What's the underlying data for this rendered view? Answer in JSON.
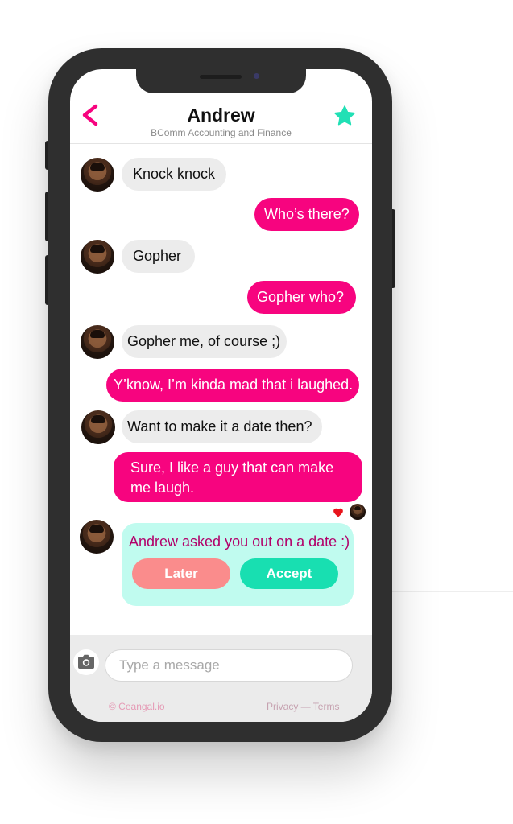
{
  "header": {
    "title": "Andrew",
    "subtitle": "BComm Accounting and Finance"
  },
  "messages": [
    {
      "from": "them",
      "text": "Knock knock"
    },
    {
      "from": "me",
      "text": "Who’s there?"
    },
    {
      "from": "them",
      "text": "Gopher"
    },
    {
      "from": "me",
      "text": "Gopher who?"
    },
    {
      "from": "them",
      "text": "Gopher me, of course ;)"
    },
    {
      "from": "me",
      "text": "Y’know, I’m kinda mad that i laughed."
    },
    {
      "from": "them",
      "text": "Want to make it a date then?"
    },
    {
      "from": "me",
      "text": "Sure, I like a guy that can make me laugh."
    }
  ],
  "date_invite": {
    "text": "Andrew asked you out on a date :)",
    "later_label": "Later",
    "accept_label": "Accept"
  },
  "composer": {
    "placeholder": "Type a message"
  },
  "footer": {
    "copyright": "© Ceangal.io",
    "privacy": "Privacy",
    "separator": " — ",
    "terms": "Terms"
  },
  "colors": {
    "accent_pink": "#f7047f",
    "star_teal": "#21e0b5",
    "accept_teal": "#18dfb1",
    "later_coral": "#fa8c8c",
    "card_mint": "#c0fbef",
    "heart_red": "#e8141c"
  },
  "icons": {
    "back": "chevron-left-icon",
    "favorite": "star-icon",
    "reaction": "heart-icon",
    "attach": "camera-icon"
  }
}
